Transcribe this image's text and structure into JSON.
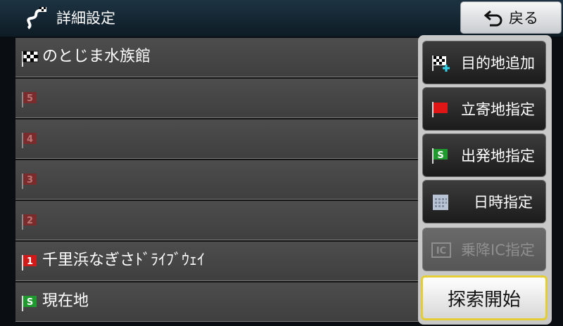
{
  "header": {
    "title": "詳細設定",
    "title_icon": "route-icon",
    "back_label": "戻る",
    "back_icon": "back-arrow-icon"
  },
  "route": {
    "rows": [
      {
        "label": "のとじま水族館",
        "flag": "destination",
        "flag_text": ""
      },
      {
        "label": "",
        "flag": "waypoint-5",
        "flag_text": "5"
      },
      {
        "label": "",
        "flag": "waypoint-4",
        "flag_text": "4"
      },
      {
        "label": "",
        "flag": "waypoint-3",
        "flag_text": "3"
      },
      {
        "label": "",
        "flag": "waypoint-2",
        "flag_text": "2"
      },
      {
        "label": "千里浜なぎさﾄﾞﾗｲﾌﾞｳｪｲ",
        "flag": "waypoint-1",
        "flag_text": "1"
      },
      {
        "label": "現在地",
        "flag": "start",
        "flag_text": "S"
      }
    ]
  },
  "menu": {
    "add_destination": "目的地追加",
    "set_waypoint": "立寄地指定",
    "set_departure": "出発地指定",
    "set_datetime": "日時指定",
    "set_ic": "乗降IC指定",
    "ic_icon_text": "IC",
    "search": "探索開始"
  },
  "colors": {
    "waypoint_red": "#d11a1a",
    "waypoint_faded": "#7a2b2b",
    "start_green": "#1f9a2e",
    "search_border": "#e3cf35"
  }
}
